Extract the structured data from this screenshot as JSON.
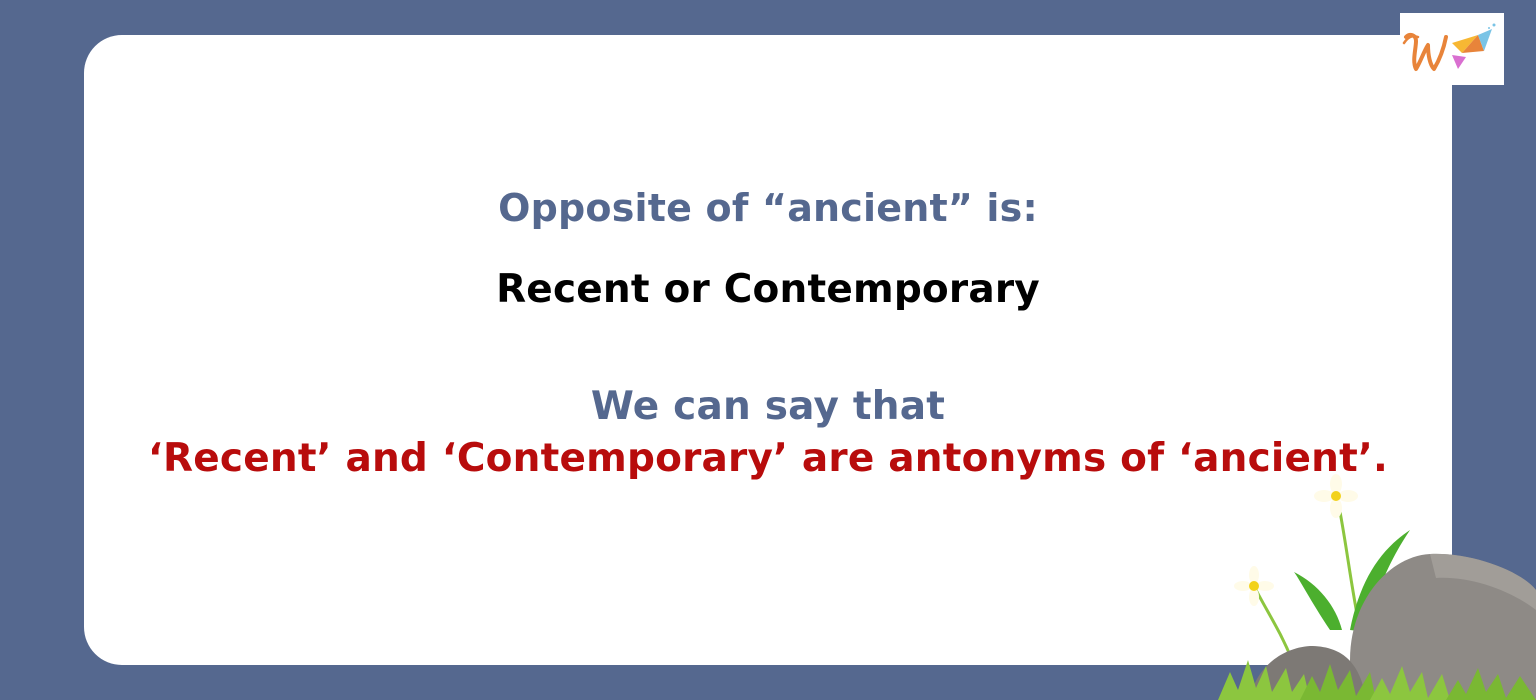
{
  "slide": {
    "heading": "Opposite of “ancient” is:",
    "answer": "Recent or Contemporary",
    "explanation_lead": "We can say that",
    "explanation_statement": "‘Recent’ and ‘Contemporary’ are antonyms of ‘ancient’."
  },
  "logo": {
    "icon": "w-brand-logo-icon",
    "letter_color": "#e8843a",
    "flag_colors": [
      "#f7b733",
      "#e8843a",
      "#7ac4e6",
      "#d96fd0"
    ]
  },
  "decoration": {
    "icons": [
      "rock-icon",
      "grass-icon",
      "flower-icon"
    ]
  },
  "colors": {
    "background": "#55688f",
    "card": "#ffffff",
    "heading": "#55688f",
    "answer": "#000000",
    "statement": "#b80c0c"
  }
}
